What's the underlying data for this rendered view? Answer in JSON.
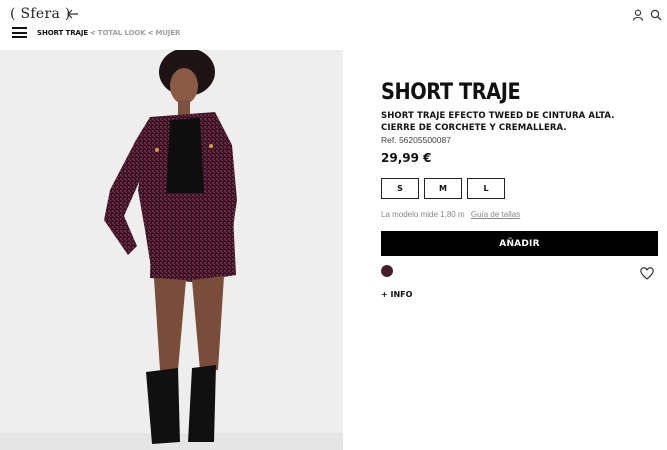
{
  "header": {
    "logo": "( Sfera )",
    "breadcrumb": [
      {
        "label": "SHORT TRAJE"
      },
      {
        "label": "TOTAL LOOK"
      },
      {
        "label": "MUJER"
      }
    ],
    "separator": "<"
  },
  "product": {
    "title": "SHORT TRAJE",
    "description": "SHORT TRAJE EFECTO TWEED DE CINTURA ALTA. CIERRE DE CORCHETE Y CREMALLERA.",
    "ref": "Ref. 56205500087",
    "price": "29,99 €",
    "sizes": [
      "S",
      "M",
      "L"
    ],
    "model_text": "La modelo mide 1,80 m",
    "size_guide": "Guía de tallas",
    "add_button": "AÑADIR",
    "more_info": "+ INFO",
    "swatch_color": "#4a1a2c"
  },
  "icons": {
    "back": "arrow-left-icon",
    "user": "user-icon",
    "search": "search-icon",
    "menu": "menu-icon",
    "wishlist": "heart-icon"
  }
}
